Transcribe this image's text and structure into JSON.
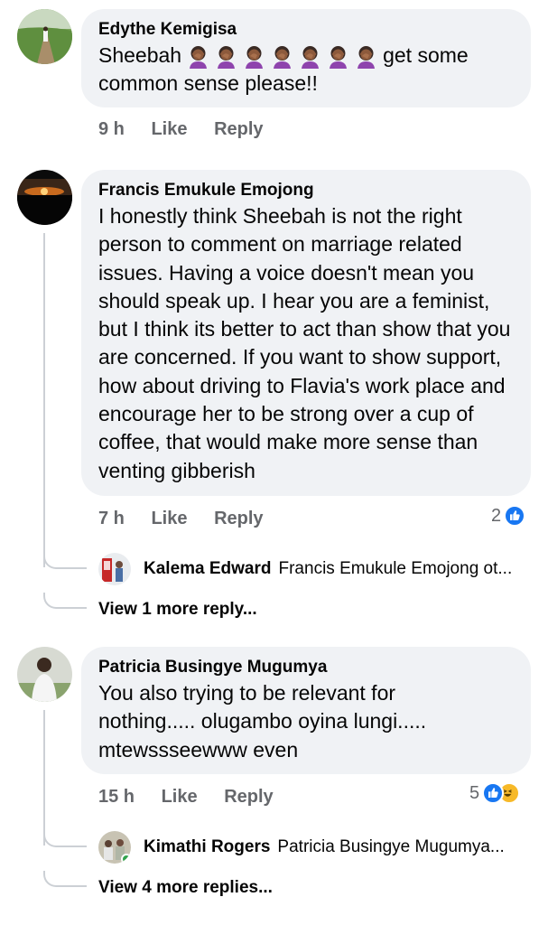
{
  "comments": [
    {
      "author": "Edythe Kemigisa",
      "text_before_emoji": "Sheebah",
      "emoji_icon": "woman-facepalming-icon",
      "emoji_count": 7,
      "text_after_emoji": "get some",
      "text_line2": "common sense please!!",
      "time": "9 h",
      "like_label": "Like",
      "reply_label": "Reply"
    },
    {
      "author": "Francis Emukule Emojong",
      "text": "I honestly think Sheebah is not the right person to comment on marriage related issues. Having a voice doesn't mean you should speak up. I hear you are a feminist, but I think its better to act than show that you are concerned. If you want to show support, how about driving to Flavia's work place and encourage her to be strong over a cup of coffee, that would make more sense than venting gibberish",
      "time": "7 h",
      "like_label": "Like",
      "reply_label": "Reply",
      "reaction_count": "2",
      "reactions": [
        "like-icon"
      ],
      "reply_preview": {
        "name": "Kalema Edward",
        "snippet": "Francis Emukule Emojong ot..."
      },
      "more_replies": "View 1 more reply..."
    },
    {
      "author": "Patricia Busingye Mugumya",
      "text": "You also trying to be relevant for nothing..... olugambo oyina lungi..... mtewssseewww even",
      "time": "15 h",
      "like_label": "Like",
      "reply_label": "Reply",
      "reaction_count": "5",
      "reactions": [
        "like-icon",
        "haha-icon"
      ],
      "reply_preview": {
        "name": "Kimathi Rogers",
        "snippet": "Patricia Busingye Mugumya..."
      },
      "more_replies": "View 4 more replies..."
    }
  ],
  "colors": {
    "bubble": "#f0f2f5",
    "meta_text": "#65676b",
    "like_blue": "#1877f2",
    "online_green": "#31a24c"
  }
}
